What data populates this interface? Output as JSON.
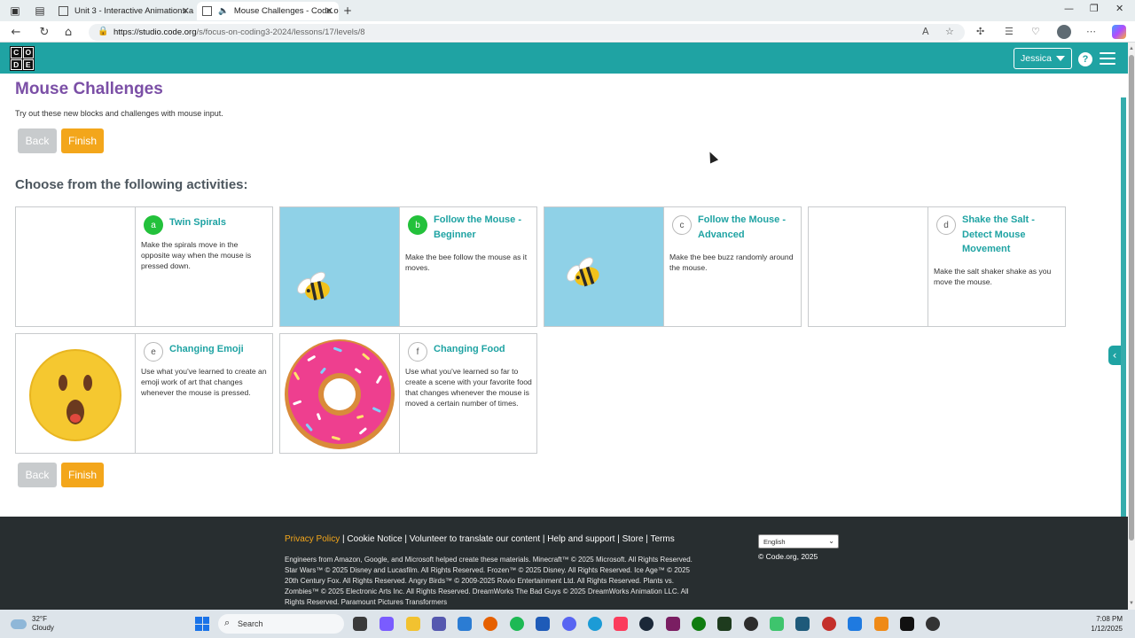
{
  "browser": {
    "tabs": [
      {
        "title": "Unit 3 - Interactive Animations a"
      },
      {
        "title": "Mouse Challenges - Code.o"
      }
    ],
    "url_host": "https://studio.code.org",
    "url_path": "/s/focus-on-coding3-2024/lessons/17/levels/8"
  },
  "header": {
    "logo_letters": [
      "C",
      "O",
      "D",
      "E"
    ],
    "user_name": "Jessica",
    "help_glyph": "?"
  },
  "page": {
    "title": "Mouse Challenges",
    "description": "Try out these new blocks and challenges with mouse input.",
    "back_label": "Back",
    "finish_label": "Finish",
    "section_title": "Choose from the following activities:"
  },
  "activities": [
    {
      "letter": "a",
      "title": "Twin Spirals",
      "description": "Make the spirals move in the opposite way when the mouse is pressed down.",
      "completed": true
    },
    {
      "letter": "b",
      "title": "Follow the Mouse - Beginner",
      "description": "Make the bee follow the mouse as it moves.",
      "completed": true
    },
    {
      "letter": "c",
      "title": "Follow the Mouse - Advanced",
      "description": "Make the bee buzz randomly around the mouse.",
      "completed": false
    },
    {
      "letter": "d",
      "title": "Shake the Salt - Detect Mouse Movement",
      "description": "Make the salt shaker shake as you move the mouse.",
      "completed": false
    },
    {
      "letter": "e",
      "title": "Changing Emoji",
      "description": "Use what you've learned to create an emoji work of art that changes whenever the mouse is pressed.",
      "completed": false
    },
    {
      "letter": "f",
      "title": "Changing Food",
      "description": "Use what you've learned so far to create a scene with your favorite food that changes whenever the mouse is moved a certain number of times.",
      "completed": false
    }
  ],
  "footer": {
    "privacy": "Privacy Policy",
    "links_rest": " | Cookie Notice | Volunteer to translate our content | Help and support | Store | Terms",
    "language": "English",
    "copyright": "© Code.org, 2025",
    "legal": "Engineers from Amazon, Google, and Microsoft helped create these materials. Minecraft™ © 2025 Microsoft. All Rights Reserved. Star Wars™ © 2025 Disney and Lucasfilm. All Rights Reserved. Frozen™ © 2025 Disney. All Rights Reserved. Ice Age™ © 2025 20th Century Fox. All Rights Reserved. Angry Birds™ © 2009-2025 Rovio Entertainment Ltd. All Rights Reserved. Plants vs. Zombies™ © 2025 Electronic Arts Inc. All Rights Reserved. DreamWorks The Bad Guys © 2025 DreamWorks Animation LLC. All Rights Reserved. Paramount Pictures Transformers"
  },
  "taskbar": {
    "temperature": "32°F",
    "weather": "Cloudy",
    "search_placeholder": "Search",
    "time": "7:08 PM",
    "date": "1/12/2025"
  },
  "colors": {
    "teal": "#1fa3a3",
    "purple_title": "#7b4fa6",
    "orange_finish": "#f3a61b",
    "green_complete": "#23c13b",
    "footer_bg": "#282e30"
  }
}
